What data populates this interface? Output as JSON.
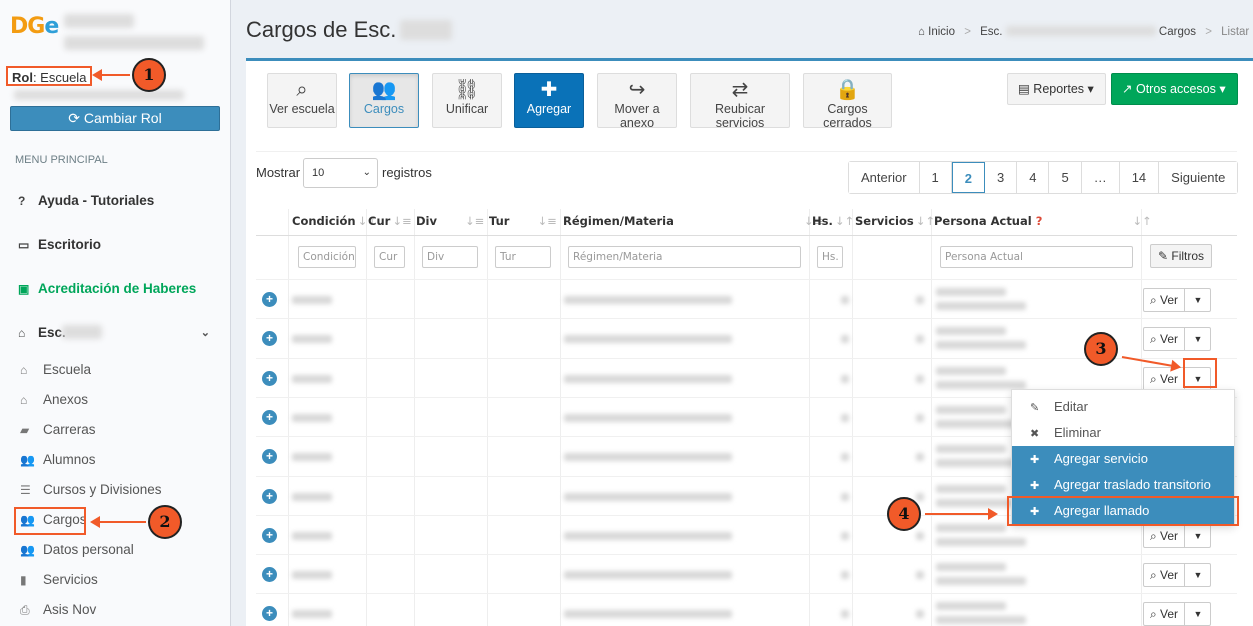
{
  "sidebar": {
    "logo": "DGE",
    "rol_label": "Rol",
    "rol_value": ": Escuela",
    "cambiar_rol": "Cambiar Rol",
    "menu_header": "MENU PRINCIPAL",
    "items": [
      {
        "label": "Ayuda - Tutoriales",
        "icon": "question-icon"
      },
      {
        "label": "Escritorio",
        "icon": "laptop-icon"
      },
      {
        "label": "Acreditación de Haberes",
        "icon": "money-icon"
      },
      {
        "label": "Esc.",
        "icon": "home-icon"
      }
    ],
    "submenu": [
      {
        "label": "Escuela",
        "icon": "home-icon"
      },
      {
        "label": "Anexos",
        "icon": "home-icon"
      },
      {
        "label": "Carreras",
        "icon": "book-icon"
      },
      {
        "label": "Alumnos",
        "icon": "users-icon"
      },
      {
        "label": "Cursos y Divisiones",
        "icon": "list-icon"
      },
      {
        "label": "Cargos",
        "icon": "users-icon"
      },
      {
        "label": "Datos personal",
        "icon": "users-icon"
      },
      {
        "label": "Servicios",
        "icon": "bookmark-icon"
      },
      {
        "label": "Asis Nov",
        "icon": "print-icon"
      }
    ]
  },
  "header": {
    "title": "Cargos de Esc.",
    "breadcrumb": {
      "inicio": "Inicio",
      "esc": "Esc.",
      "cargos": "Cargos",
      "listar": "Listar"
    }
  },
  "toolbar": {
    "ver_escuela": "Ver escuela",
    "cargos": "Cargos",
    "unificar": "Unificar",
    "agregar": "Agregar",
    "mover_anexo": "Mover a anexo",
    "reubicar": "Reubicar servicios",
    "cerrados": "Cargos cerrados",
    "reportes": "Reportes",
    "otros": "Otros accesos"
  },
  "list": {
    "mostrar": "Mostrar",
    "page_size": "10",
    "registros": "registros",
    "pages": [
      "Anterior",
      "1",
      "2",
      "3",
      "4",
      "5",
      "…",
      "14",
      "Siguiente"
    ],
    "current_page": "2"
  },
  "table": {
    "headers": [
      "Condición",
      "Cur",
      "Div",
      "Tur",
      "Régimen/Materia",
      "Hs.",
      "Servicios",
      "Persona Actual"
    ],
    "required_mark": "?",
    "filters": [
      "Condición",
      "Cur",
      "Div",
      "Tur",
      "Régimen/Materia",
      "Hs.",
      "Persona Actual"
    ],
    "filtros_button": "Filtros",
    "ver_label": "Ver",
    "row_count": 9
  },
  "dropdown": {
    "items": [
      "Editar",
      "Eliminar",
      "Agregar servicio",
      "Agregar traslado transitorio",
      "Agregar llamado"
    ]
  },
  "annotations": [
    "1",
    "2",
    "3",
    "4"
  ],
  "colors": {
    "primary": "#3c8dbc",
    "success": "#00a65a",
    "annotation": "#f15a29"
  }
}
